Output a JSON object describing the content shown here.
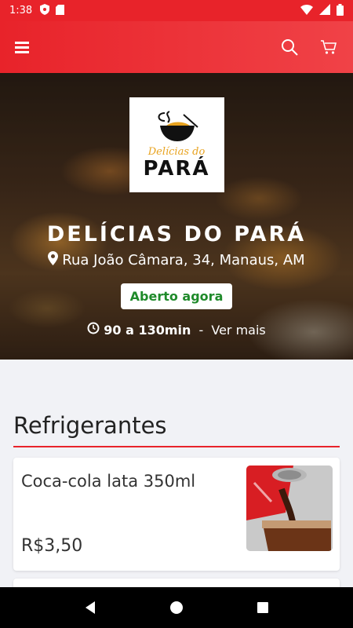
{
  "status_bar": {
    "time": "1:38"
  },
  "app_bar": {
    "menu_icon": "hamburger-menu-icon",
    "search_icon": "search-icon",
    "cart_icon": "cart-icon",
    "accent_color": "#e8232a"
  },
  "hero": {
    "logo": {
      "script": "Delícias do",
      "word": "PARÁ"
    },
    "name": "DELÍCIAS DO PARÁ",
    "address": "Rua João Câmara, 34, Manaus, AM",
    "status_badge": "Aberto agora",
    "delivery_time": "90 a 130min",
    "delivery_separator": " - ",
    "see_more": "Ver mais"
  },
  "menu": {
    "section_title": "Refrigerantes",
    "products": [
      {
        "name": "Coca-cola lata 350ml",
        "price": "R$3,50"
      }
    ]
  }
}
